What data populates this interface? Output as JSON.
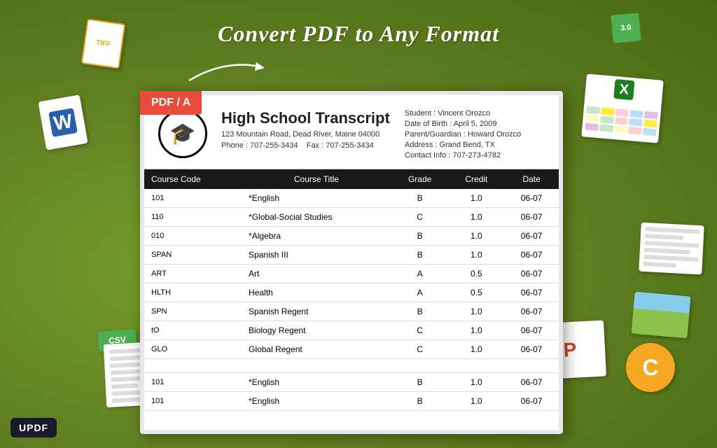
{
  "page": {
    "title": "Convert PDF to Any Format",
    "background_color": "#6b8c2a"
  },
  "badges": {
    "pdf_a": "PDF / A",
    "csv": "CSV",
    "updf": "UPDF"
  },
  "school": {
    "name": "High School Transcript",
    "address": "123 Mountain Road, Dead River, Maine 04000",
    "phone": "Phone : 707-255-3434",
    "fax": "Fax : 707-255-3434"
  },
  "student": {
    "name_label": "Student : Vincent Orozco",
    "dob_label": "Date of Birth : April 5, 2009",
    "parent_label": "Parent/Guardian : Howard Orozco",
    "address_label": "Address : Grand Bend, TX",
    "contact_label": "Contact Info : 707-273-4782"
  },
  "table": {
    "headers": [
      "Course Code",
      "Course Title",
      "Grade",
      "Credit",
      "Date"
    ],
    "rows": [
      [
        "101",
        "*English",
        "B",
        "1.0",
        "06-07"
      ],
      [
        "110",
        "*Global-Social Studies",
        "C",
        "1.0",
        "06-07"
      ],
      [
        "010",
        "*Algebra",
        "B",
        "1.0",
        "06-07"
      ],
      [
        "SPAN",
        "Spanish III",
        "B",
        "1.0",
        "06-07"
      ],
      [
        "ART",
        "Art",
        "A",
        "0.5",
        "06-07"
      ],
      [
        "HLTH",
        "Health",
        "A",
        "0.5",
        "06-07"
      ],
      [
        "SPN",
        "Spanish Regent",
        "B",
        "1.0",
        "06-07"
      ],
      [
        "tO",
        "Biology Regent",
        "C",
        "1.0",
        "06-07"
      ],
      [
        "GLO",
        "Global Regent",
        "C",
        "1.0",
        "06-07"
      ],
      [
        "",
        "",
        "",
        "",
        ""
      ],
      [
        "101",
        "*English",
        "B",
        "1.0",
        "06-07"
      ],
      [
        "101",
        "*English",
        "B",
        "1.0",
        "06-07"
      ]
    ]
  }
}
